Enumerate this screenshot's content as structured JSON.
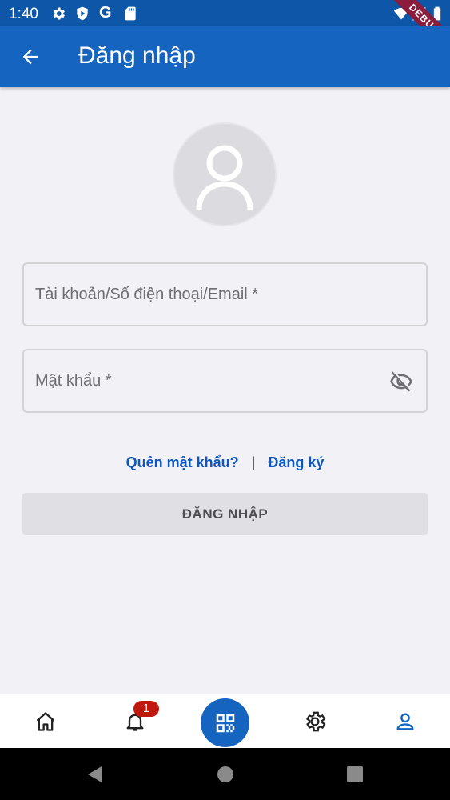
{
  "status_bar": {
    "time": "1:40",
    "g_label": "G",
    "left_icons": [
      "gear-icon",
      "shield-play-icon",
      "google-icon",
      "sd-card-icon"
    ],
    "right_icons": [
      "wifi-icon",
      "signal-icon",
      "battery-icon"
    ]
  },
  "debug_banner": "DEBUG",
  "app_bar": {
    "title": "Đăng nhập",
    "back_icon": "arrow-left-icon"
  },
  "form": {
    "username_placeholder": "Tài khoản/Số điện thoại/Email *",
    "username_value": "",
    "password_placeholder": "Mật khẩu *",
    "password_value": "",
    "password_toggle_icon": "eye-off-icon"
  },
  "links": {
    "forgot": "Quên mật khẩu?",
    "separator": "|",
    "register": "Đăng ký"
  },
  "login_button_label": "ĐĂNG NHẬP",
  "bottom_nav": {
    "items": [
      "home-icon",
      "bell-icon",
      "qr-code-icon",
      "settings-icon",
      "person-icon"
    ],
    "notification_badge": "1",
    "active_item": "person-icon"
  },
  "colors": {
    "primary": "#1565c0",
    "status_bar": "#0d56a8",
    "link": "#0d56c0",
    "badge": "#c0180e",
    "background": "#f2f1f5"
  }
}
